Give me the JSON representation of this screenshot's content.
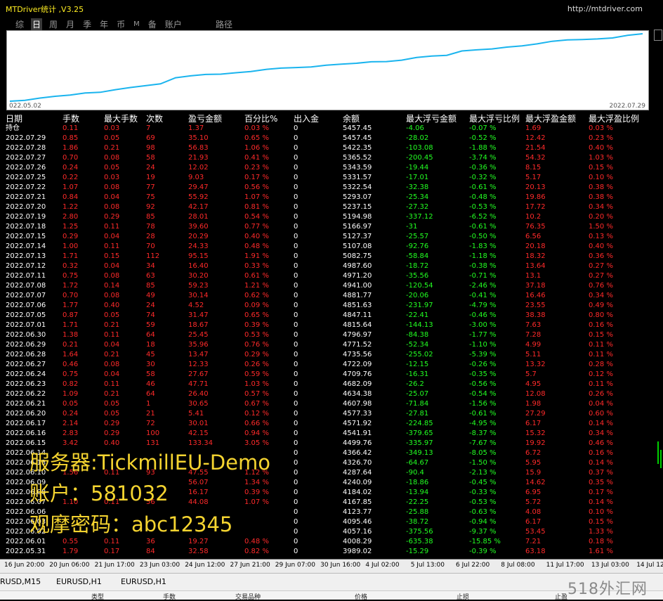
{
  "window": {
    "title": "MTDriver统计 ,V3.25",
    "url": "http://mtdriver.com"
  },
  "tabs": [
    "综",
    "日",
    "周",
    "月",
    "季",
    "年",
    "币",
    "M",
    "备",
    "账户"
  ],
  "active_tab": "日",
  "route_label": "路径",
  "equity_chart": {
    "start_date": "022.05.02",
    "end_date": "2022.07.29",
    "line_color": "#1ab4ee",
    "balance": [
      3989.02,
      4008.29,
      4057.16,
      4095.46,
      4123.77,
      4167.85,
      4184.02,
      4240.09,
      4287.64,
      4326.7,
      4366.42,
      4499.76,
      4541.91,
      4571.92,
      4577.33,
      4607.98,
      4634.38,
      4682.09,
      4709.76,
      4722.09,
      4735.56,
      4771.52,
      4796.97,
      4815.64,
      4847.11,
      4851.63,
      4881.77,
      4941.0,
      4971.2,
      4987.6,
      5082.75,
      5107.08,
      5127.37,
      5166.97,
      5194.98,
      5237.15,
      5293.07,
      5322.54,
      5331.57,
      5343.59,
      5365.52,
      5422.35,
      5457.45
    ]
  },
  "table": {
    "headers": [
      "日期",
      "手数",
      "最大手数",
      "次数",
      "盈亏金额",
      "百分比%",
      "出入金",
      "余额",
      "最大浮亏金额",
      "最大浮亏比例",
      "最大浮盈金额",
      "最大浮盈比例"
    ],
    "rows": [
      [
        "持仓",
        "0.11",
        "0.03",
        "7",
        "1.37",
        "0.03 %",
        "0",
        "5457.45",
        "-4.06",
        "-0.07 %",
        "1.69",
        "0.03 %"
      ],
      [
        "2022.07.29",
        "0.85",
        "0.05",
        "69",
        "35.10",
        "0.65 %",
        "0",
        "5457.45",
        "-28.02",
        "-0.52 %",
        "12.42",
        "0.23 %"
      ],
      [
        "2022.07.28",
        "1.86",
        "0.21",
        "98",
        "56.83",
        "1.06 %",
        "0",
        "5422.35",
        "-103.08",
        "-1.88 %",
        "21.54",
        "0.40 %"
      ],
      [
        "2022.07.27",
        "0.70",
        "0.08",
        "58",
        "21.93",
        "0.41 %",
        "0",
        "5365.52",
        "-200.45",
        "-3.74 %",
        "54.32",
        "1.03 %"
      ],
      [
        "2022.07.26",
        "0.24",
        "0.05",
        "24",
        "12.02",
        "0.23 %",
        "0",
        "5343.59",
        "-19.44",
        "-0.36 %",
        "8.15",
        "0.15 %"
      ],
      [
        "2022.07.25",
        "0.22",
        "0.03",
        "19",
        "9.03",
        "0.17 %",
        "0",
        "5331.57",
        "-17.01",
        "-0.32 %",
        "5.17",
        "0.10 %"
      ],
      [
        "2022.07.22",
        "1.07",
        "0.08",
        "77",
        "29.47",
        "0.56 %",
        "0",
        "5322.54",
        "-32.38",
        "-0.61 %",
        "20.13",
        "0.38 %"
      ],
      [
        "2022.07.21",
        "0.84",
        "0.04",
        "75",
        "55.92",
        "1.07 %",
        "0",
        "5293.07",
        "-25.34",
        "-0.48 %",
        "19.86",
        "0.38 %"
      ],
      [
        "2022.07.20",
        "1.22",
        "0.08",
        "92",
        "42.17",
        "0.81 %",
        "0",
        "5237.15",
        "-27.32",
        "-0.53 %",
        "17.72",
        "0.34 %"
      ],
      [
        "2022.07.19",
        "2.80",
        "0.29",
        "85",
        "28.01",
        "0.54 %",
        "0",
        "5194.98",
        "-337.12",
        "-6.52 %",
        "10.2",
        "0.20 %"
      ],
      [
        "2022.07.18",
        "1.25",
        "0.11",
        "78",
        "39.60",
        "0.77 %",
        "0",
        "5166.97",
        "-31",
        "-0.61 %",
        "76.35",
        "1.50 %"
      ],
      [
        "2022.07.15",
        "0.29",
        "0.04",
        "28",
        "20.29",
        "0.40 %",
        "0",
        "5127.37",
        "-25.57",
        "-0.50 %",
        "6.56",
        "0.13 %"
      ],
      [
        "2022.07.14",
        "1.00",
        "0.11",
        "70",
        "24.33",
        "0.48 %",
        "0",
        "5107.08",
        "-92.76",
        "-1.83 %",
        "20.18",
        "0.40 %"
      ],
      [
        "2022.07.13",
        "1.71",
        "0.15",
        "112",
        "95.15",
        "1.91 %",
        "0",
        "5082.75",
        "-58.84",
        "-1.18 %",
        "18.32",
        "0.36 %"
      ],
      [
        "2022.07.12",
        "0.32",
        "0.04",
        "34",
        "16.40",
        "0.33 %",
        "0",
        "4987.60",
        "-18.72",
        "-0.38 %",
        "13.64",
        "0.27 %"
      ],
      [
        "2022.07.11",
        "0.75",
        "0.08",
        "63",
        "30.20",
        "0.61 %",
        "0",
        "4971.20",
        "-35.56",
        "-0.71 %",
        "13.1",
        "0.27 %"
      ],
      [
        "2022.07.08",
        "1.72",
        "0.14",
        "85",
        "59.23",
        "1.21 %",
        "0",
        "4941.00",
        "-120.54",
        "-2.46 %",
        "37.18",
        "0.76 %"
      ],
      [
        "2022.07.07",
        "0.70",
        "0.08",
        "49",
        "30.14",
        "0.62 %",
        "0",
        "4881.77",
        "-20.06",
        "-0.41 %",
        "16.46",
        "0.34 %"
      ],
      [
        "2022.07.06",
        "1.77",
        "0.40",
        "24",
        "4.52",
        "0.09 %",
        "0",
        "4851.63",
        "-231.97",
        "-4.79 %",
        "23.55",
        "0.49 %"
      ],
      [
        "2022.07.05",
        "0.87",
        "0.05",
        "74",
        "31.47",
        "0.65 %",
        "0",
        "4847.11",
        "-22.41",
        "-0.46 %",
        "38.38",
        "0.80 %"
      ],
      [
        "2022.07.01",
        "1.71",
        "0.21",
        "59",
        "18.67",
        "0.39 %",
        "0",
        "4815.64",
        "-144.13",
        "-3.00 %",
        "7.63",
        "0.16 %"
      ],
      [
        "2022.06.30",
        "1.38",
        "0.11",
        "64",
        "25.45",
        "0.53 %",
        "0",
        "4796.97",
        "-84.38",
        "-1.77 %",
        "7.28",
        "0.15 %"
      ],
      [
        "2022.06.29",
        "0.21",
        "0.04",
        "18",
        "35.96",
        "0.76 %",
        "0",
        "4771.52",
        "-52.34",
        "-1.10 %",
        "4.99",
        "0.11 %"
      ],
      [
        "2022.06.28",
        "1.64",
        "0.21",
        "45",
        "13.47",
        "0.29 %",
        "0",
        "4735.56",
        "-255.02",
        "-5.39 %",
        "5.11",
        "0.11 %"
      ],
      [
        "2022.06.27",
        "0.46",
        "0.08",
        "30",
        "12.33",
        "0.26 %",
        "0",
        "4722.09",
        "-12.15",
        "-0.26 %",
        "13.32",
        "0.28 %"
      ],
      [
        "2022.06.24",
        "0.75",
        "0.04",
        "58",
        "27.67",
        "0.59 %",
        "0",
        "4709.76",
        "-16.31",
        "-0.35 %",
        "5.7",
        "0.12 %"
      ],
      [
        "2022.06.23",
        "0.82",
        "0.11",
        "46",
        "47.71",
        "1.03 %",
        "0",
        "4682.09",
        "-26.2",
        "-0.56 %",
        "4.95",
        "0.11 %"
      ],
      [
        "2022.06.22",
        "1.09",
        "0.21",
        "64",
        "26.40",
        "0.57 %",
        "0",
        "4634.38",
        "-25.07",
        "-0.54 %",
        "12.08",
        "0.26 %"
      ],
      [
        "2022.06.21",
        "0.05",
        "0.05",
        "1",
        "30.65",
        "0.67 %",
        "0",
        "4607.98",
        "-71.84",
        "-1.56 %",
        "1.98",
        "0.04 %"
      ],
      [
        "2022.06.20",
        "0.24",
        "0.05",
        "21",
        "5.41",
        "0.12 %",
        "0",
        "4577.33",
        "-27.81",
        "-0.61 %",
        "27.29",
        "0.60 %"
      ],
      [
        "2022.06.17",
        "2.14",
        "0.29",
        "72",
        "30.01",
        "0.66 %",
        "0",
        "4571.92",
        "-224.85",
        "-4.95 %",
        "6.17",
        "0.14 %"
      ],
      [
        "2022.06.16",
        "2.83",
        "0.29",
        "100",
        "42.15",
        "0.94 %",
        "0",
        "4541.91",
        "-379.65",
        "-8.37 %",
        "15.32",
        "0.34 %"
      ],
      [
        "2022.06.15",
        "3.42",
        "0.40",
        "131",
        "133.34",
        "3.05 %",
        "0",
        "4499.76",
        "-335.97",
        "-7.67 %",
        "19.92",
        "0.46 %"
      ],
      [
        "2022.06.14",
        "",
        "",
        "",
        "",
        "",
        "0",
        "4366.42",
        "-349.13",
        "-8.05 %",
        "6.72",
        "0.16 %"
      ],
      [
        "2022.06.13",
        "",
        "",
        "",
        "",
        "",
        "0",
        "4326.70",
        "-64.67",
        "-1.50 %",
        "5.95",
        "0.14 %"
      ],
      [
        "2022.06.10",
        "1.56",
        "0.11",
        "93",
        "47.55",
        "1.12 %",
        "0",
        "4287.64",
        "-90.4",
        "-2.13 %",
        "15.9",
        "0.37 %"
      ],
      [
        "2022.06.09",
        "",
        "",
        "",
        "56.07",
        "1.34 %",
        "0",
        "4240.09",
        "-18.86",
        "-0.45 %",
        "14.62",
        "0.35 %"
      ],
      [
        "2022.06.08",
        "",
        "",
        "",
        "16.17",
        "0.39 %",
        "0",
        "4184.02",
        "-13.94",
        "-0.33 %",
        "6.95",
        "0.17 %"
      ],
      [
        "2022.06.07",
        "1.10",
        "0.11",
        "56",
        "44.08",
        "1.07 %",
        "0",
        "4167.85",
        "-22.25",
        "-0.53 %",
        "5.72",
        "0.14 %"
      ],
      [
        "2022.06.06",
        "",
        "",
        "",
        "",
        "",
        "0",
        "4123.77",
        "-25.88",
        "-0.63 %",
        "4.08",
        "0.10 %"
      ],
      [
        "2022.06.03",
        "",
        "",
        "",
        "",
        "",
        "0",
        "4095.46",
        "-38.72",
        "-0.94 %",
        "6.17",
        "0.15 %"
      ],
      [
        "2022.06.02",
        "",
        "",
        "",
        "",
        "",
        "0",
        "4057.16",
        "-375.56",
        "-9.37 %",
        "53.45",
        "1.33 %"
      ],
      [
        "2022.06.01",
        "0.55",
        "0.11",
        "36",
        "19.27",
        "0.48 %",
        "0",
        "4008.29",
        "-635.38",
        "-15.85 %",
        "7.21",
        "0.18 %"
      ],
      [
        "2022.05.31",
        "1.79",
        "0.17",
        "84",
        "32.58",
        "0.82 %",
        "0",
        "3989.02",
        "-15.29",
        "-0.39 %",
        "63.18",
        "1.61 %"
      ]
    ]
  },
  "overlay": {
    "server": "服务器:TickmillEU-Demo",
    "account": "账户：581032",
    "password": "观摩密码：abc12345",
    "color": "#f5d430"
  },
  "time_axis": [
    "16 Jun 20:00",
    "20 Jun 06:00",
    "21 Jun 17:00",
    "23 Jun 03:00",
    "24 Jun 12:00",
    "27 Jun 21:00",
    "29 Jun 07:00",
    "30 Jun 16:00",
    "4 Jul 02:00",
    "5 Jul 13:00",
    "6 Jul 22:00",
    "8 Jul 08:00",
    "11 Jul 17:00",
    "13 Jul 03:00",
    "14 Jul 12:"
  ],
  "symbol_tabs": [
    "RUSD,M15",
    "EURUSD,H1",
    "EURUSD,H1"
  ],
  "bottom_headers": [
    "类型",
    "手数",
    "交易品种",
    "价格",
    "止损",
    "止盈"
  ],
  "watermark": "518外汇网"
}
